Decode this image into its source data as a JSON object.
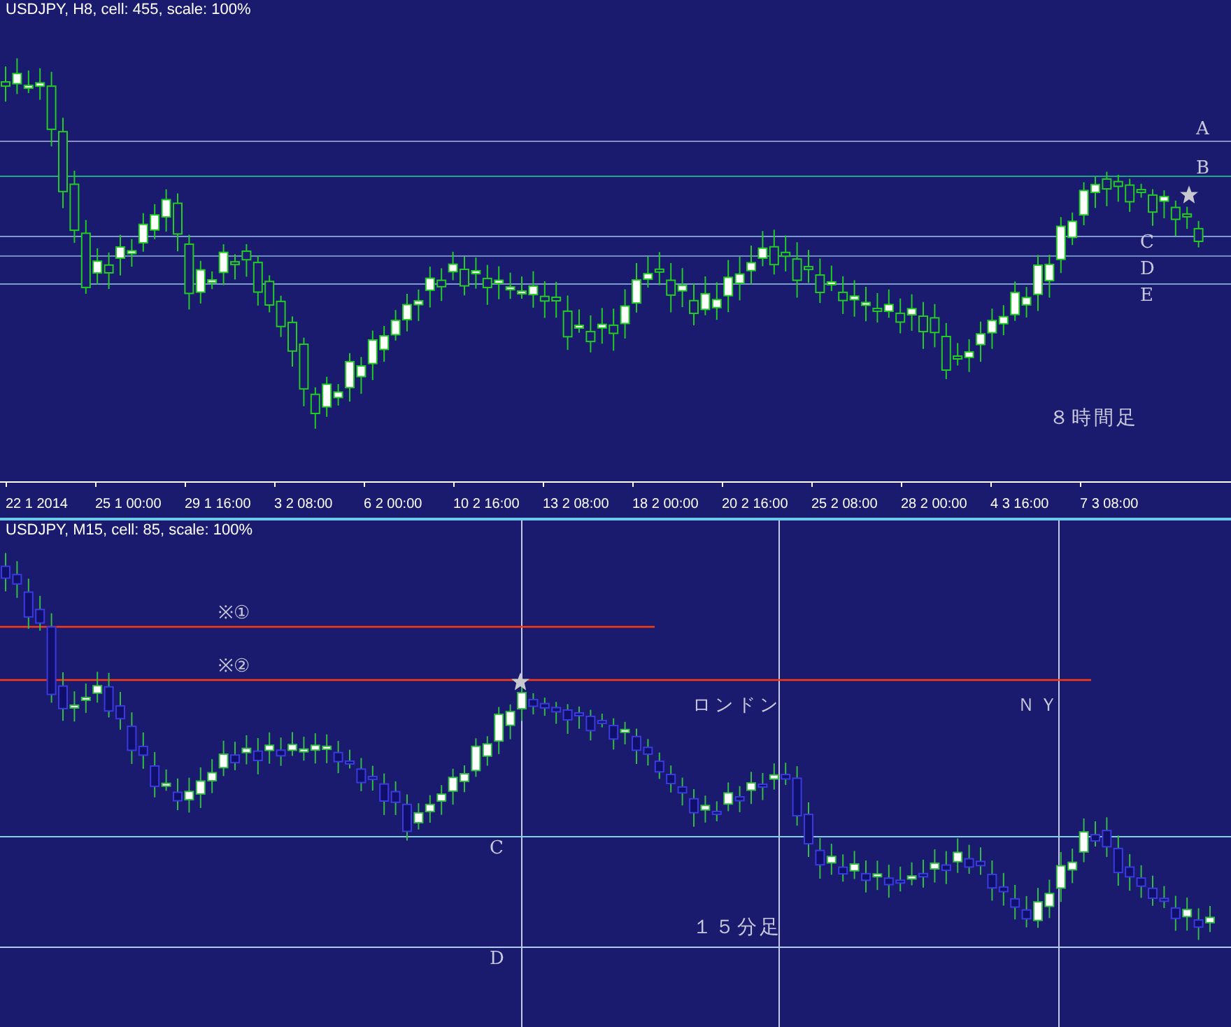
{
  "top_chart": {
    "header": "USDJPY, H8, cell: 455, scale: 100%",
    "levels": [
      {
        "label": "A"
      },
      {
        "label": "B"
      },
      {
        "label": "C"
      },
      {
        "label": "D"
      },
      {
        "label": "E"
      }
    ],
    "caption": "８時間足",
    "axis_labels": [
      "22 1 2014",
      "25 1 00:00",
      "29 1 16:00",
      "3 2 08:00",
      "6 2 00:00",
      "10 2 16:00",
      "13 2 08:00",
      "18 2 00:00",
      "20 2 16:00",
      "25 2 08:00",
      "28 2 00:00",
      "4 3 16:00",
      "7 3 08:00"
    ]
  },
  "bottom_chart": {
    "header": "USDJPY, M15, cell: 85, scale: 100%",
    "lines": [
      {
        "label": "※①"
      },
      {
        "label": "※②"
      }
    ],
    "levels": [
      {
        "label": "C"
      },
      {
        "label": "D"
      }
    ],
    "sessions": [
      {
        "label": "ロンドン"
      },
      {
        "label": "ＮＹ"
      }
    ],
    "caption": "１５分足"
  }
}
